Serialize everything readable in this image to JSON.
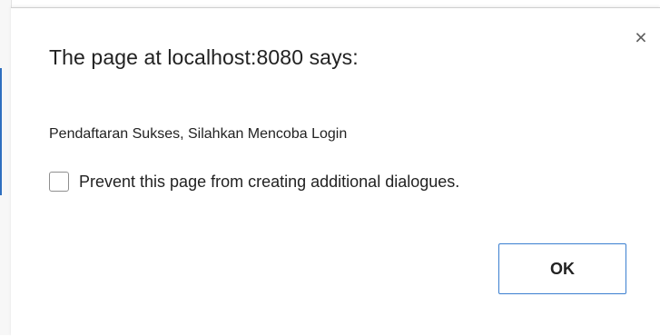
{
  "dialog": {
    "title": "The page at localhost:8080 says:",
    "close_icon": "close-icon",
    "close_glyph": "×",
    "message": "Pendaftaran Sukses, Silahkan Mencoba Login",
    "checkbox_label": "Prevent this page from creating additional dialogues.",
    "checkbox_checked": false,
    "ok_label": "OK"
  },
  "colors": {
    "focus_border": "#3b7fd0",
    "text": "#222222"
  }
}
